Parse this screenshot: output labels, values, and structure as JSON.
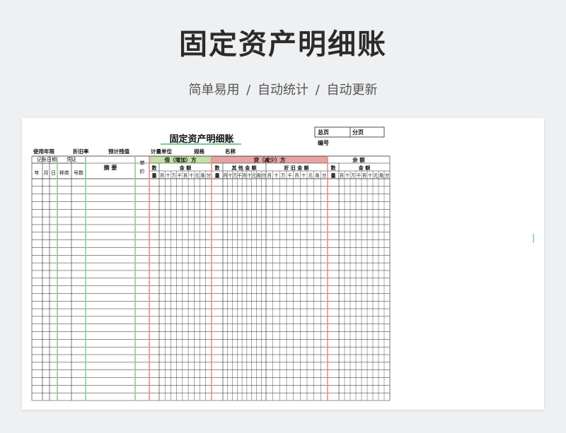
{
  "banner": {
    "title": "固定资产明细账",
    "subtitle": "简单易用  /  自动统计  /  自动更新"
  },
  "ledger": {
    "title": "固定资产明细账",
    "title_color": "#22b04a",
    "header_box": {
      "total_pages": "总页",
      "sub_pages": "分页",
      "number": "编号"
    },
    "info_fields": [
      "使用年限",
      "折旧率",
      "预计残值",
      "计量单位",
      "规格",
      "名称"
    ],
    "headers": {
      "record_date": "记账日期",
      "voucher": "凭证",
      "summary": "摘  要",
      "unit_price_1": "单",
      "unit_price_2": "价",
      "debit": "借（增加）方",
      "credit": "贷（减少）方",
      "balance": "余  额",
      "qty_1": "数",
      "qty_2": "量",
      "amount": "金  额",
      "other_amount": "其 他 金 额",
      "depreciation_amount": "折 旧 金 额",
      "year": "年",
      "month": "月",
      "day": "日",
      "kind": "种类",
      "number": "号数"
    },
    "digits": [
      "百",
      "十",
      "万",
      "千",
      "百",
      "十",
      "元",
      "角",
      "分"
    ],
    "blank_rows": 29,
    "colors": {
      "debit_fill": "#c5dfa4",
      "credit_fill": "#e6a3a3",
      "green_line": "#7ed29a",
      "red_line": "#e88a8a"
    }
  }
}
